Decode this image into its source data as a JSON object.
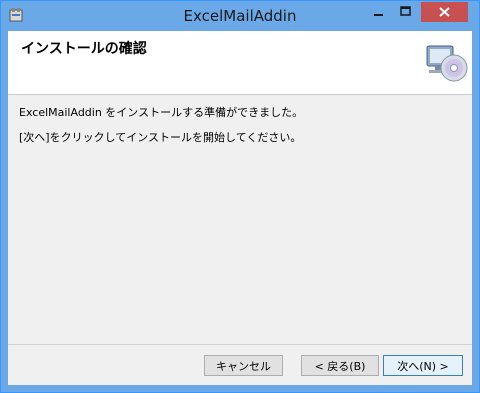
{
  "window": {
    "title": "ExcelMailAddin"
  },
  "header": {
    "title": "インストールの確認"
  },
  "messages": {
    "line1": "ExcelMailAddin をインストールする準備ができました。",
    "line2": "[次へ]をクリックしてインストールを開始してください。"
  },
  "buttons": {
    "cancel": "キャンセル",
    "back": "< 戻る(B)",
    "next": "次へ(N) >"
  },
  "icons": {
    "app": "installer-icon",
    "header": "computer-cd-icon",
    "minimize": "minimize-icon",
    "maximize": "maximize-icon",
    "close": "close-icon"
  },
  "colors": {
    "titlebar": "#6aa8e8",
    "close_button": "#c75050",
    "client_bg": "#f0f0f0"
  }
}
